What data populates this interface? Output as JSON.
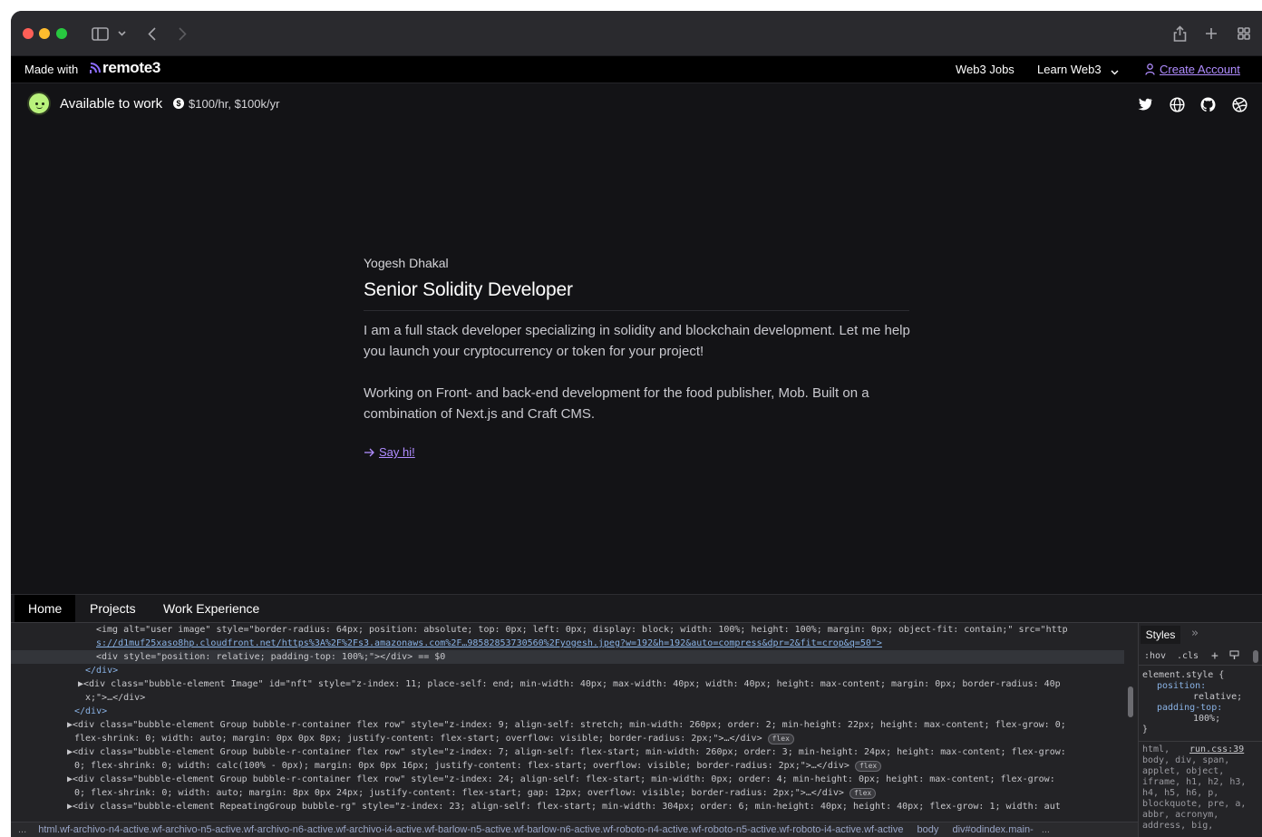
{
  "browser": {
    "icons": [
      "sidebar-toggle-icon",
      "chevron-down-icon",
      "back-icon",
      "forward-icon",
      "share-icon",
      "new-tab-icon",
      "tab-overview-icon"
    ]
  },
  "site_bar": {
    "made_with": "Made with",
    "brand": "remote3",
    "nav": {
      "web3_jobs": "Web3 Jobs",
      "learn_web3": "Learn Web3",
      "create_account": "Create Account"
    }
  },
  "status": {
    "availability": "Available to work",
    "rate": "$100/hr, $100k/yr",
    "social_icons": [
      "twitter-icon",
      "globe-icon",
      "github-icon",
      "dribbble-icon"
    ]
  },
  "profile": {
    "name": "Yogesh Dhakal",
    "title": "Senior Solidity Developer",
    "bio_1": "I am a full stack developer specializing in solidity and blockchain development. Let me help you launch your cryptocurrency or token for your project!",
    "bio_2": "Working on Front- and back-end development for the food publisher, Mob. Built on a combination of Next.js and Craft CMS.",
    "say_hi": "Say hi!"
  },
  "page_tabs": [
    "Home",
    "Projects",
    "Work Experience"
  ],
  "devtools": {
    "dom_lines": [
      "<img alt=\"user image\" style=\"border-radius: 64px; position: absolute; top: 0px; left: 0px; display: block; width: 100%; height: 100%; margin: 0px; object-fit: contain;\" src=\"http",
      "s://d1muf25xaso8hp.cloudfront.net/https%3A%2F%2Fs3.amazonaws.com%2F…98582853730560%2Fyogesh.jpeg?w=192&h=192&auto=compress&dpr=2&fit=crop&q=50\">",
      "<div style=\"position: relative; padding-top: 100%;\"></div> == $0",
      "</div>",
      "▶<div class=\"bubble-element Image\" id=\"nft\" style=\"z-index: 11; place-self: end; min-width: 40px; max-width: 40px; width: 40px; height: max-content; margin: 0px; border-radius: 40p",
      "x;\">…</div>",
      "</div>",
      "▶<div class=\"bubble-element Group bubble-r-container flex row\" style=\"z-index: 9; align-self: stretch; min-width: 260px; order: 2; min-height: 22px; height: max-content; flex-grow: 0;",
      "flex-shrink: 0; width: auto; margin: 0px 0px 8px; justify-content: flex-start; overflow: visible; border-radius: 2px;\">…</div>",
      "▶<div class=\"bubble-element Group bubble-r-container flex row\" style=\"z-index: 7; align-self: flex-start; min-width: 260px; order: 3; min-height: 24px; height: max-content; flex-grow:",
      "0; flex-shrink: 0; width: calc(100% - 0px); margin: 0px 0px 16px; justify-content: flex-start; overflow: visible; border-radius: 2px;\">…</div>",
      "▶<div class=\"bubble-element Group bubble-r-container flex row\" style=\"z-index: 24; align-self: flex-start; min-width: 0px; order: 4; min-height: 0px; height: max-content; flex-grow:",
      "0; flex-shrink: 0; width: auto; margin: 8px 0px 24px; justify-content: flex-start; gap: 12px; overflow: visible; border-radius: 2px;\">…</div>",
      "▶<div class=\"bubble-element RepeatingGroup bubble-rg\" style=\"z-index: 23; align-self: flex-start; min-width: 304px; order: 6; min-height: 40px; height: 40px; flex-grow: 1; width: aut"
    ],
    "flex_badge": "flex",
    "breadcrumb_path": "html.wf-archivo-n4-active.wf-archivo-n5-active.wf-archivo-n6-active.wf-archivo-i4-active.wf-barlow-n5-active.wf-barlow-n6-active.wf-roboto-n4-active.wf-roboto-n5-active.wf-roboto-i4-active.wf-active",
    "breadcrumb_body": "body",
    "breadcrumb_div": "div#odindex.main-",
    "ellipsis": "...",
    "styles": {
      "tab": "Styles",
      "more": "»",
      "hov": ":hov",
      "cls": ".cls",
      "rule_selector": "element.style {",
      "rule_body_1": "position:",
      "rule_body_2": "relative;",
      "rule_body_3": "padding-top:",
      "rule_body_4": "100%;",
      "rule_close": "}",
      "inherited_selector": "html,",
      "inherited_source": "run.css:39",
      "inherited_list": "body, div, span, applet, object, iframe, h1, h2, h3, h4, h5, h6, p, blockquote, pre, a, abbr, acronym, address, big,"
    }
  }
}
